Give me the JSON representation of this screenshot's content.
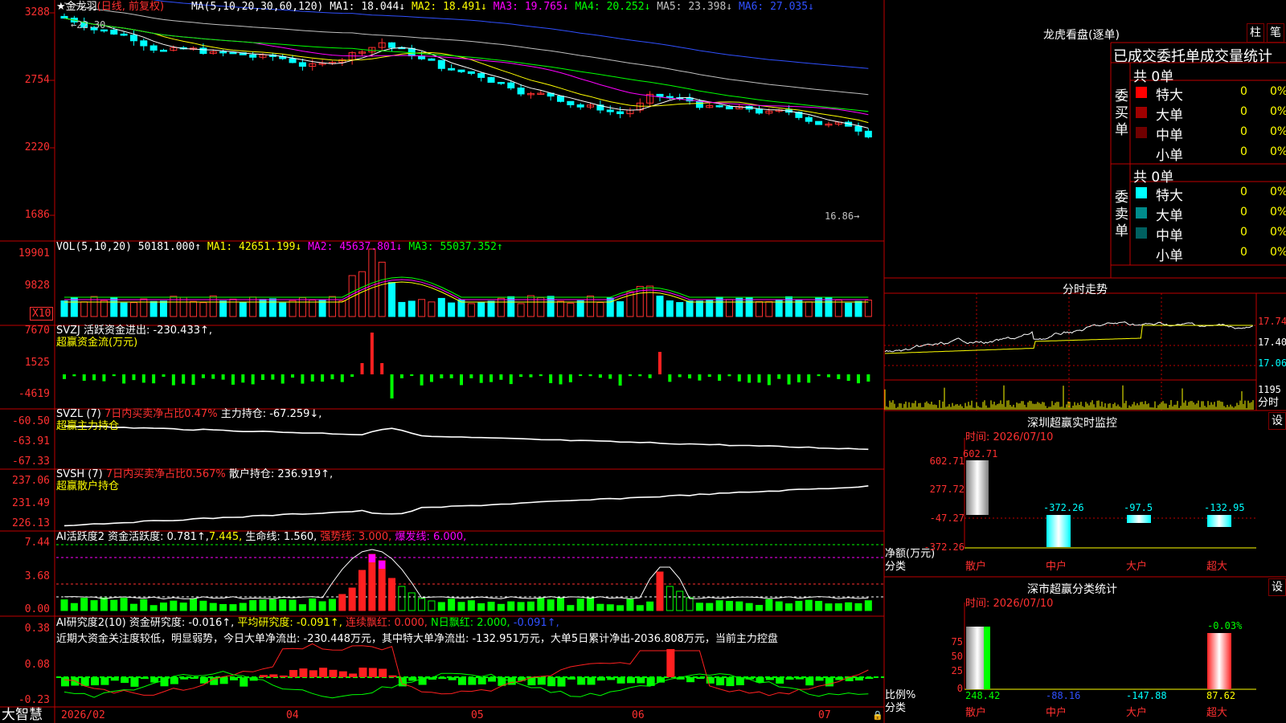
{
  "header": {
    "stock_name": "金龙羽",
    "period": "(日线, 前复权)",
    "ma_label": "MA(5,10,20,30,60,120)",
    "ma1": "MA1: 18.044↓",
    "ma2": "MA2: 18.491↓",
    "ma3": "MA3: 19.765↓",
    "ma4": "MA4: 20.252↓",
    "ma5": "MA5: 23.398↓",
    "ma6": "MA6: 27.035↓",
    "high_mark": "22.30",
    "low_mark": "16.86"
  },
  "price_axis": [
    "3288",
    "2754",
    "2220",
    "1686"
  ],
  "vol": {
    "label": "VOL(5,10,20)",
    "value": "50181.000↑",
    "ma1": "MA1: 42651.199↓",
    "ma2": "MA2: 45637.801↓",
    "ma3": "MA3: 55037.352↑",
    "axis": [
      "19901",
      "9828"
    ],
    "unit_badge": "X10"
  },
  "svzj": {
    "label": "SVZJ",
    "line1": "活跃资金进出: -230.433↑,",
    "line2": "超赢资金流(万元)",
    "axis": [
      "7670",
      "1525",
      "-4619"
    ]
  },
  "svzl": {
    "label": "SVZL (7)",
    "ratio": "7日内买卖净占比0.47%",
    "hold": "主力持仓: -67.259↓,",
    "line2": "超赢主力持仓",
    "axis": [
      "-60.50",
      "-63.91",
      "-67.33"
    ]
  },
  "svsh": {
    "label": "SVSH (7)",
    "ratio": "7日内买卖净占比0.567%",
    "hold": "散户持仓: 236.919↑,",
    "line2": "超赢散户持仓",
    "axis": [
      "237.06",
      "231.49",
      "226.13"
    ]
  },
  "ai_active": {
    "label": "AI活跃度2",
    "a": "资金活跃度: 0.781↑,",
    "b": "7.445,",
    "c": "生命线: 1.560,",
    "d": "强势线: 3.000,",
    "e": "爆发线: 6.000,",
    "axis": [
      "7.44",
      "3.68",
      "0.00"
    ]
  },
  "ai_research": {
    "label": "AI研究度2(10)",
    "a": "资金研究度: -0.016↑,",
    "b": "平均研究度: -0.091↑,",
    "c": "连续飘红: 0.000,",
    "d": "N日飘红: 2.000,",
    "e": "-0.091↑,",
    "comment": "近期大资金关注度较低，明显弱势，今日大单净流出: -230.448万元，其中特大单净流出: -132.951万元，大单5日累计净出-2036.808万元，当前主力控盘",
    "axis": [
      "0.38",
      "0.08",
      "-0.23"
    ]
  },
  "bottom": {
    "brand": "大智慧",
    "dates": [
      "2026/02",
      "04",
      "05",
      "06",
      "07"
    ]
  },
  "dragon_tiger": {
    "title": "龙虎看盘(逐单)",
    "btn_bar": "柱",
    "btn_count": "笔",
    "tabs": "已成交委托单成交量统计",
    "buy_label": "委买单",
    "sell_label": "委卖单",
    "buy_total": "共 0单",
    "sell_total": "共 0单",
    "buy_rows": [
      {
        "name": "特大",
        "count": "0",
        "pct": "0%",
        "color": "#ff0000"
      },
      {
        "name": "大单",
        "count": "0",
        "pct": "0%",
        "color": "#a00000"
      },
      {
        "name": "中单",
        "count": "0",
        "pct": "0%",
        "color": "#700000"
      },
      {
        "name": "小单",
        "count": "0",
        "pct": "0%",
        "color": ""
      }
    ],
    "sell_rows": [
      {
        "name": "特大",
        "count": "0",
        "pct": "0%",
        "color": "#00ffff"
      },
      {
        "name": "大单",
        "count": "0",
        "pct": "0%",
        "color": "#008b8b"
      },
      {
        "name": "中单",
        "count": "0",
        "pct": "0%",
        "color": "#006060"
      },
      {
        "name": "小单",
        "count": "0",
        "pct": "0%",
        "color": ""
      }
    ]
  },
  "intraday": {
    "title": "分时走势",
    "axis": [
      "17.74",
      "17.40",
      "17.06"
    ],
    "vol_axis": "1195",
    "label": "分时"
  },
  "sz_monitor": {
    "title": "深圳超赢实时监控",
    "set": "设",
    "time": "时间: 2026/07/10",
    "axis": [
      "602.71",
      "277.72",
      "-47.27",
      "-372.26"
    ],
    "net_label": "净额(万元)",
    "cat_label": "分类",
    "categories": [
      "散户",
      "中户",
      "大户",
      "超大"
    ],
    "values": [
      "602.71",
      "-372.26",
      "-97.5",
      "-132.95"
    ]
  },
  "sz_class": {
    "title": "深市超赢分类统计",
    "set": "设",
    "time": "时间: 2026/07/10",
    "axis": [
      "75",
      "50",
      "25",
      "0"
    ],
    "ratio_label": "比例%",
    "cat_label": "分类",
    "categories": [
      "散户",
      "中户",
      "大户",
      "超大"
    ],
    "values": [
      "248.42",
      "-88.16",
      "-147.88",
      "87.62"
    ],
    "top_label": "-0.03%"
  }
}
